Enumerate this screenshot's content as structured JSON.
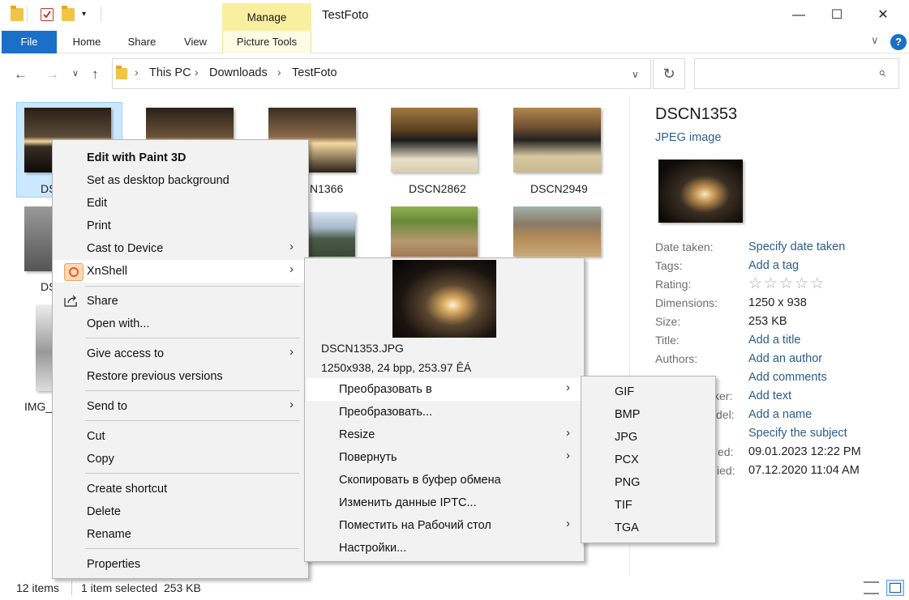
{
  "window": {
    "title": "TestFoto",
    "contextual_tab": "Manage",
    "min": "—",
    "max": "☐",
    "close": "✕"
  },
  "ribbon": {
    "tabs": [
      "File",
      "Home",
      "Share",
      "View",
      "Picture Tools"
    ],
    "collapse": "∨",
    "help": "?"
  },
  "address": {
    "crumbs": [
      "This PC",
      "Downloads",
      "TestFoto"
    ],
    "sep": "›",
    "back": "←",
    "forward": "→",
    "recent": "∨",
    "up": "↑",
    "dropdown": "∨",
    "refresh": "↻",
    "search_icon": "⌕"
  },
  "files": {
    "labels": [
      "DS",
      "N1366",
      "DSCN2862",
      "DSCN2949",
      "DS",
      "IMG_"
    ]
  },
  "preview": {
    "name": "DSCN1353",
    "type": "JPEG image",
    "properties": [
      {
        "label": "Date taken:",
        "value": "Specify date taken"
      },
      {
        "label": "Tags:",
        "value": "Add a tag"
      },
      {
        "label": "Rating:",
        "value": "☆☆☆☆☆"
      },
      {
        "label": "Dimensions:",
        "value": "1250 x 938"
      },
      {
        "label": "Size:",
        "value": "253 KB"
      },
      {
        "label": "Title:",
        "value": "Add a title"
      },
      {
        "label": "Authors:",
        "value": "Add an author"
      },
      {
        "label": "",
        "value": "Add comments"
      },
      {
        "label": "ker:",
        "value": "Add text"
      },
      {
        "label": "del:",
        "value": "Add a name"
      },
      {
        "label": "",
        "value": "Specify the subject"
      },
      {
        "label": "ed:",
        "value": "09.01.2023 12:22 PM"
      },
      {
        "label": "ied:",
        "value": "07.12.2020 11:04 AM"
      }
    ]
  },
  "status": {
    "items": "12 items",
    "selected": "1 item selected  253 KB"
  },
  "context_menu": {
    "items": [
      "Edit with Paint 3D",
      "Set as desktop background",
      "Edit",
      "Print",
      "Cast to Device",
      "XnShell",
      "Share",
      "Open with...",
      "Give access to",
      "Restore previous versions",
      "Send to",
      "Cut",
      "Copy",
      "Create shortcut",
      "Delete",
      "Rename",
      "Properties"
    ],
    "arrow": "›"
  },
  "xnshell_menu": {
    "filename": "DSCN1353.JPG",
    "info": "1250x938, 24 bpp, 253.97 ÊÁ",
    "items": [
      "Преобразовать в",
      "Преобразовать...",
      "Resize",
      "Повернуть",
      "Скопировать в буфер обмена",
      "Изменить данные IPTC...",
      "Поместить на Рабочий стол",
      "Настройки..."
    ]
  },
  "format_menu": {
    "items": [
      "GIF",
      "BMP",
      "JPG",
      "PCX",
      "PNG",
      "TIF",
      "TGA"
    ]
  },
  "colors": {
    "accent": "#1a6fc7",
    "manage_tab": "#f8f0a0",
    "selection": "#cce8ff",
    "menu_bg": "#f2f2f2"
  }
}
